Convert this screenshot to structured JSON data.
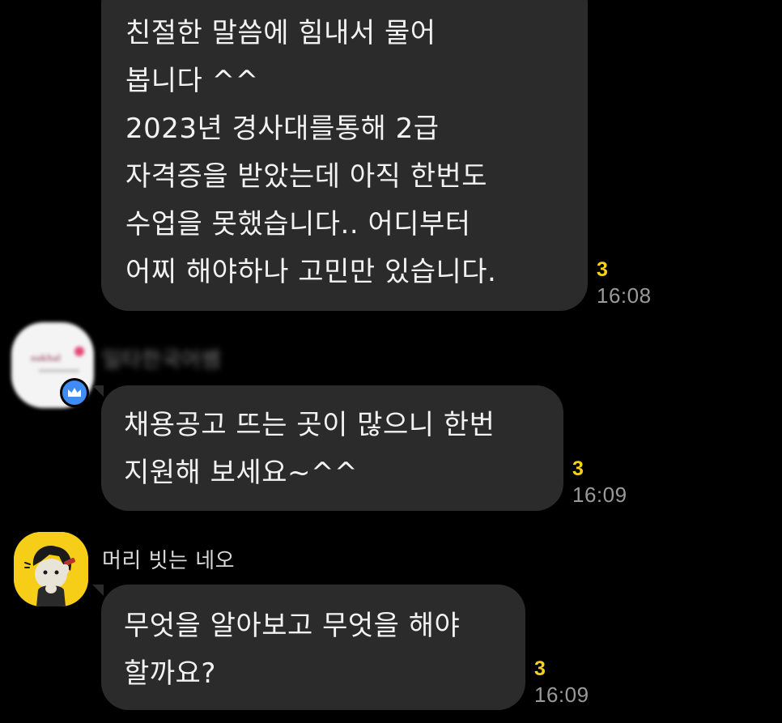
{
  "messages": [
    {
      "lines": [
        "친절한 말씀에 힘내서 물어",
        "봅니다 ^^",
        "2023년 경사대를통해 2급",
        "자격증을 받았는데 아직 한번도",
        "수업을 못했습니다.. 어디부터",
        "어찌 해야하나 고민만 있습니다."
      ],
      "unread": "3",
      "time": "16:08"
    },
    {
      "sender": "일타한국어쌤",
      "lines": [
        "채용공고 뜨는 곳이 많으니 한번",
        "지원해 보세요~^^"
      ],
      "unread": "3",
      "time": "16:09"
    },
    {
      "sender": "머리 빗는 네오",
      "lines": [
        "무엇을 알아보고 무엇을 해야",
        "할까요?"
      ],
      "unread": "3",
      "time": "16:09"
    }
  ],
  "avatars": {
    "teacher_logo_text": "oakhal",
    "neo_icon": "neo-character-icon",
    "badge_icon": "crown-icon"
  },
  "colors": {
    "background": "#000000",
    "bubble": "#2b2b2b",
    "unread": "#f7d21a",
    "time": "#9a9a9a",
    "badge": "#3f8df4",
    "neo_avatar": "#f7ce17"
  }
}
